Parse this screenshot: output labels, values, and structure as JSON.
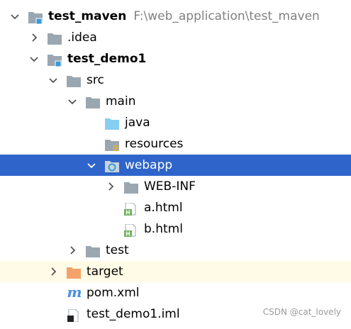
{
  "tree": {
    "root": {
      "label": "test_maven",
      "path": "F:\\web_application\\test_maven"
    },
    "idea": {
      "label": ".idea"
    },
    "module": {
      "label": "test_demo1"
    },
    "src": {
      "label": "src"
    },
    "main": {
      "label": "main"
    },
    "java": {
      "label": "java"
    },
    "resources": {
      "label": "resources"
    },
    "webapp": {
      "label": "webapp"
    },
    "webinf": {
      "label": "WEB-INF"
    },
    "a_html": {
      "label": "a.html"
    },
    "b_html": {
      "label": "b.html"
    },
    "test": {
      "label": "test"
    },
    "target": {
      "label": "target"
    },
    "pom": {
      "label": "pom.xml"
    },
    "iml": {
      "label": "test_demo1.iml"
    }
  },
  "colors": {
    "selection": "#2f65ca",
    "folder": "#9aa7b0",
    "source_folder": "#87cef0",
    "excluded_folder": "#f4a26b",
    "module_marker": "#3a9ad9",
    "html_icon": "#6fb25b",
    "maven_icon": "#4a8fe0"
  },
  "watermark": {
    "text": "CSDN @cat_lovely"
  }
}
